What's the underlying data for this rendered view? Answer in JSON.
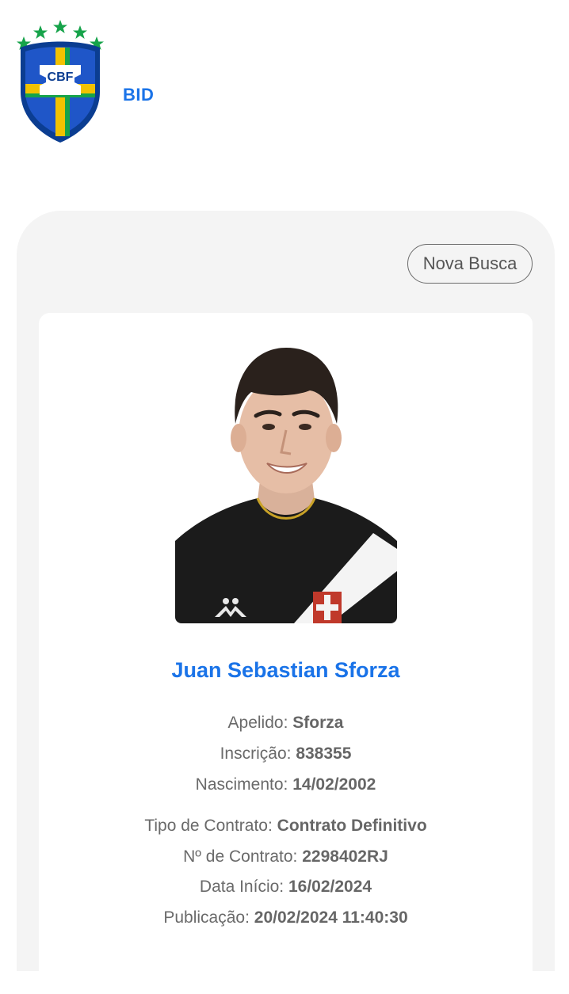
{
  "header": {
    "logo_text": "CBF",
    "app_name": "BID"
  },
  "actions": {
    "new_search_label": "Nova Busca"
  },
  "player": {
    "name": "Juan Sebastian Sforza",
    "personal": [
      {
        "label": "Apelido:",
        "value": "Sforza"
      },
      {
        "label": "Inscrição:",
        "value": "838355"
      },
      {
        "label": "Nascimento:",
        "value": "14/02/2002"
      }
    ],
    "contract": [
      {
        "label": "Tipo de Contrato:",
        "value": "Contrato Definitivo"
      },
      {
        "label": "Nº de Contrato:",
        "value": "2298402RJ"
      },
      {
        "label": "Data Início:",
        "value": "16/02/2024"
      },
      {
        "label": "Publicação:",
        "value": "20/02/2024 11:40:30"
      }
    ]
  },
  "colors": {
    "accent": "#1a73e8",
    "panel_bg": "#f4f4f4",
    "text": "#6a6a6a"
  }
}
